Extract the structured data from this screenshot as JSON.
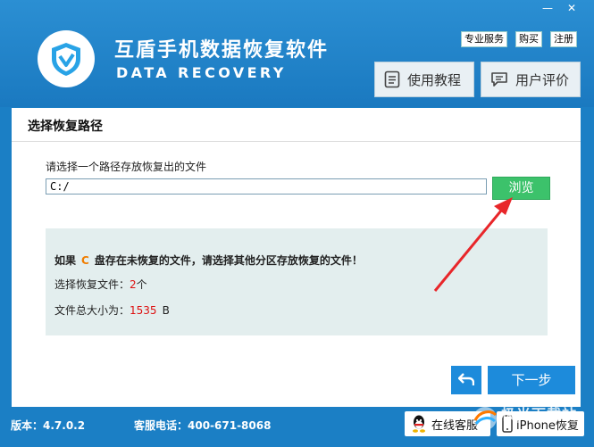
{
  "app": {
    "title": "互盾手机数据恢复软件",
    "subtitle": "DATA RECOVERY"
  },
  "window_controls": {
    "minimize": "—",
    "close": "✕"
  },
  "top_links": [
    "专业服务",
    "购买",
    "注册"
  ],
  "top_buttons": {
    "tutorial": "使用教程",
    "review": "用户评价"
  },
  "panel": {
    "title": "选择恢复路径",
    "prompt": "请选择一个路径存放恢复出的文件",
    "path_value": "C:/",
    "browse_label": "浏览"
  },
  "info": {
    "warn_prefix": "如果",
    "drive": "C",
    "warn_suffix": "盘存在未恢复的文件，请选择其他分区存放恢复的文件！",
    "selected_label": "选择恢复文件：",
    "selected_value": "2",
    "selected_unit": "个",
    "size_label": "文件总大小为：",
    "size_value": "1535",
    "size_unit": "B"
  },
  "nav": {
    "next_label": "下一步"
  },
  "footer": {
    "version": "版本：4.7.0.2",
    "hotline": "客服电话：400-671-8068",
    "online_service": "在线客服",
    "iphone_recovery": "iPhone恢复"
  },
  "colors": {
    "brand_blue": "#1b7fc5",
    "browse_green": "#3cc26b",
    "drive_orange": "#f07d00",
    "value_red": "#d11111",
    "arrow_red": "#e8262a"
  },
  "watermark": "极光下载站"
}
